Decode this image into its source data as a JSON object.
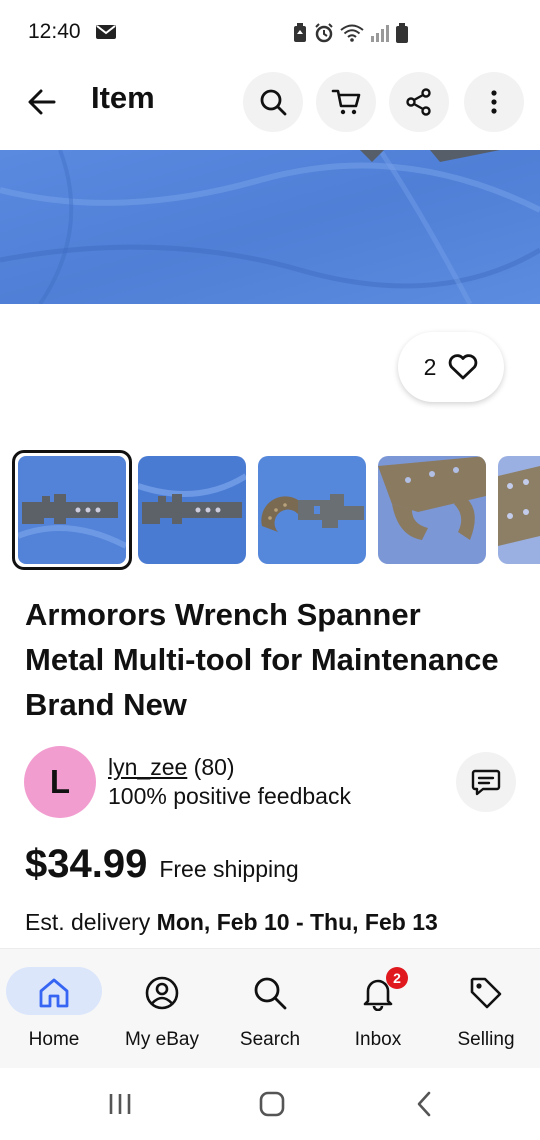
{
  "status_bar": {
    "time": "12:40",
    "icons": [
      "mail-icon",
      "battery-saver-icon",
      "alarm-icon",
      "wifi-icon",
      "signal-icon",
      "battery-icon"
    ]
  },
  "app_bar": {
    "title": "Item",
    "actions": [
      "search-icon",
      "cart-icon",
      "share-icon",
      "more-icon"
    ]
  },
  "gallery": {
    "watch_count": "2",
    "thumbnails": [
      "wrench-photo-1",
      "wrench-photo-2",
      "wrench-photo-3",
      "wrench-photo-4",
      "wrench-photo-5"
    ],
    "selected_index": 0
  },
  "listing": {
    "title": "Armorors Wrench Spanner Metal Multi-tool for Maintenance Brand New",
    "price": "$34.99",
    "shipping": "Free shipping",
    "delivery_label": "Est. delivery",
    "delivery_range": "Mon, Feb 10 - Thu, Feb 13"
  },
  "seller": {
    "initial": "L",
    "name": "lyn_zee",
    "score": "(80)",
    "feedback": "100% positive feedback"
  },
  "bottom_nav": {
    "items": [
      {
        "label": "Home",
        "icon": "home-icon",
        "active": true
      },
      {
        "label": "My eBay",
        "icon": "profile-icon",
        "active": false
      },
      {
        "label": "Search",
        "icon": "search-icon",
        "active": false
      },
      {
        "label": "Inbox",
        "icon": "bell-icon",
        "active": false,
        "badge": "2"
      },
      {
        "label": "Selling",
        "icon": "tag-icon",
        "active": false
      }
    ]
  },
  "colors": {
    "accent": "#3665f3",
    "nav_active_bg": "#dbe6fb",
    "badge": "#e0191f",
    "avatar": "#f29dd0",
    "photo_blue": "#5585d9"
  }
}
